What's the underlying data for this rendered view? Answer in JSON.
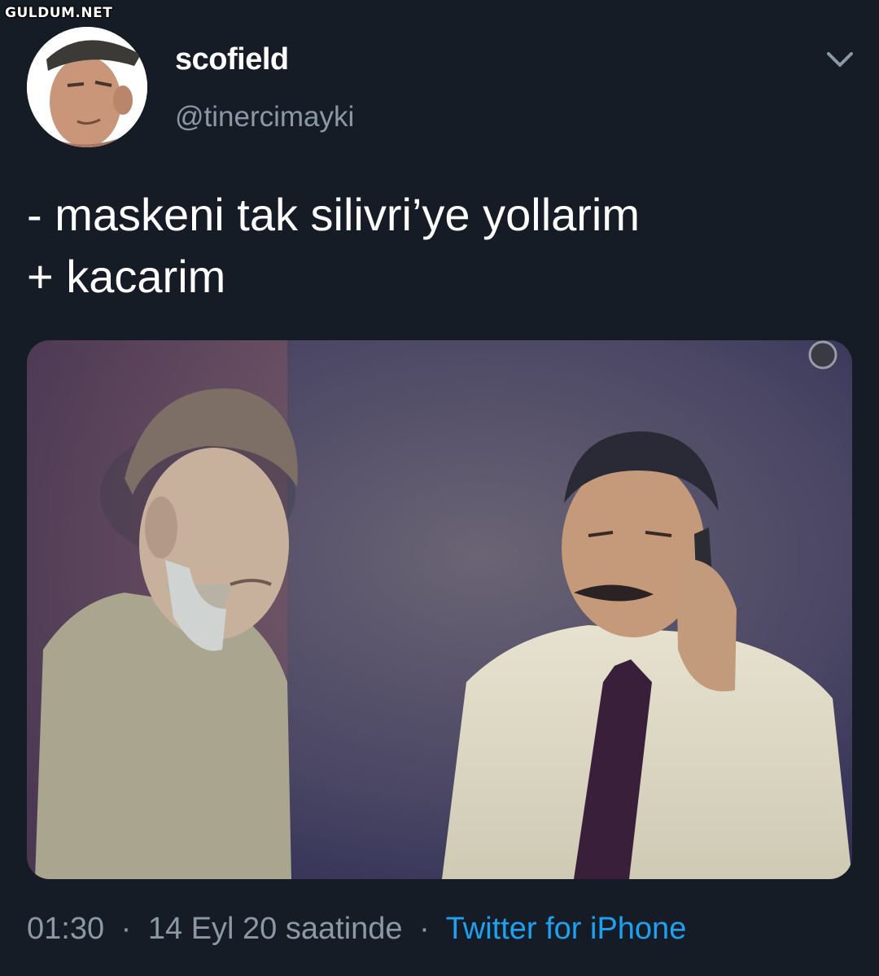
{
  "watermark": "GULDUM.NET",
  "tweet": {
    "display_name": "scofield",
    "handle": "@tinercimayki",
    "text_lines": [
      "- maskeni tak silivri’ye yollarim",
      "+ kacarim"
    ],
    "time": "01:30",
    "date_text": "14 Eyl 20 saatinde",
    "separator": "·",
    "source": "Twitter for iPhone"
  },
  "icons": {
    "more": "chevron-down-icon",
    "avatar": "profile-avatar"
  },
  "colors": {
    "background": "#151c26",
    "primary_text": "#ffffff",
    "secondary_text": "#8b98a5",
    "link": "#1da1f2"
  }
}
